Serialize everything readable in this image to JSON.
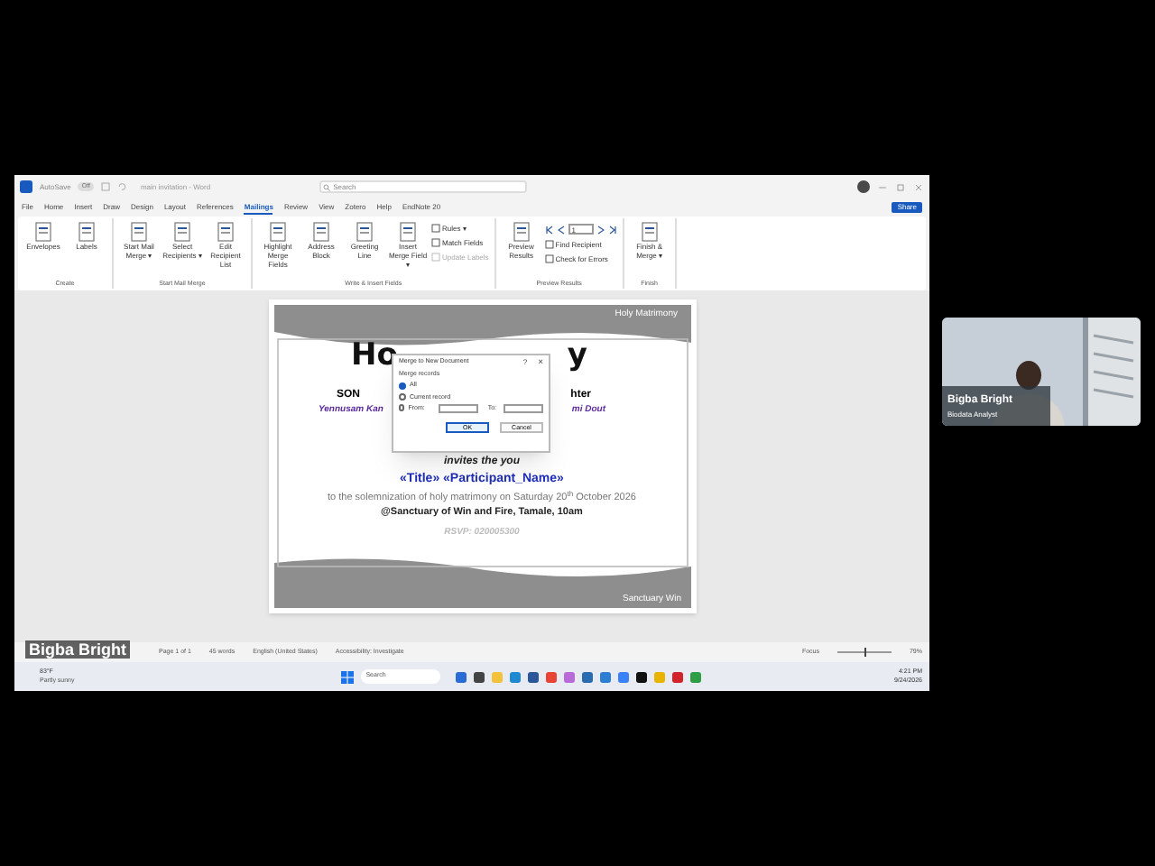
{
  "window": {
    "autosave": "AutoSave",
    "autosave_state": "Off",
    "title": "main invitation - Word",
    "search": {
      "placeholder": "Search"
    },
    "share": "Share"
  },
  "menu_tabs": [
    {
      "label": "File",
      "selected": false
    },
    {
      "label": "Home",
      "selected": false
    },
    {
      "label": "Insert",
      "selected": false
    },
    {
      "label": "Draw",
      "selected": false
    },
    {
      "label": "Design",
      "selected": false
    },
    {
      "label": "Layout",
      "selected": false
    },
    {
      "label": "References",
      "selected": false
    },
    {
      "label": "Mailings",
      "selected": true
    },
    {
      "label": "Review",
      "selected": false
    },
    {
      "label": "View",
      "selected": false
    },
    {
      "label": "Zotero",
      "selected": false
    },
    {
      "label": "Help",
      "selected": false
    },
    {
      "label": "EndNote 20",
      "selected": false
    }
  ],
  "ribbon": [
    {
      "label": "Create",
      "items": [
        {
          "kind": "large",
          "label": "Envelopes",
          "disabled": false
        },
        {
          "kind": "large",
          "label": "Labels",
          "disabled": false
        }
      ]
    },
    {
      "label": "Start Mail Merge",
      "items": [
        {
          "kind": "large",
          "label": "Start Mail Merge ▾",
          "disabled": false
        },
        {
          "kind": "large",
          "label": "Select Recipients ▾",
          "disabled": false
        },
        {
          "kind": "large",
          "label": "Edit Recipient List",
          "disabled": false
        }
      ]
    },
    {
      "label": "Write & Insert Fields",
      "items": [
        {
          "kind": "large",
          "label": "Highlight Merge Fields",
          "disabled": false
        },
        {
          "kind": "large",
          "label": "Address Block",
          "disabled": false
        },
        {
          "kind": "large",
          "label": "Greeting Line",
          "disabled": false
        },
        {
          "kind": "large",
          "label": "Insert Merge Field ▾",
          "disabled": false
        },
        {
          "kind": "small",
          "label": "Rules ▾",
          "disabled": false
        },
        {
          "kind": "small",
          "label": "Match Fields",
          "disabled": false
        },
        {
          "kind": "small",
          "label": "Update Labels",
          "disabled": true
        }
      ]
    },
    {
      "label": "Preview Results",
      "items": [
        {
          "kind": "large",
          "label": "Preview Results",
          "disabled": false
        },
        {
          "kind": "nav",
          "label": "1",
          "disabled": false
        },
        {
          "kind": "small",
          "label": "Find Recipient",
          "disabled": false
        },
        {
          "kind": "small",
          "label": "Check for Errors",
          "disabled": false
        }
      ]
    },
    {
      "label": "Finish",
      "items": [
        {
          "kind": "large",
          "label": "Finish & Merge ▾",
          "disabled": false
        }
      ]
    }
  ],
  "document": {
    "header_tag": "Holy Matrimony",
    "title_left": "Ho",
    "title_right": "y",
    "left_role": "SON",
    "right_role": "hter",
    "left_name": "Yennusam Kan",
    "right_name": "mi Dout",
    "invites": "invites the you",
    "merge_fields": "«Title» «Participant_Name»",
    "line_1": "to the solemnization of holy matrimony on Saturday 20$^{th}$ October 2026",
    "line_2": "@Sanctuary of Win and Fire, Tamale, 10am",
    "rsvp": "RSVP: 020005300",
    "footer_tag": "Sanctuary Win"
  },
  "dialog": {
    "title": "Merge to New Document",
    "help": "?",
    "close": "×",
    "group": "Merge records",
    "options": [
      {
        "label": "All",
        "selected": true
      },
      {
        "label": "Current record",
        "selected": false
      },
      {
        "label": "From:",
        "selected": false
      }
    ],
    "to_label": "To:",
    "buttons": [
      "OK",
      "Cancel"
    ]
  },
  "status_bar": {
    "left": [
      "Page 1 of 1",
      "45 words",
      "English (United States)",
      "Accessibility: Investigate"
    ],
    "focus": "Focus",
    "zoom": {
      "level": 0.5
    },
    "zoom_reading": "79%"
  },
  "taskbar": {
    "weather_temp": "83°F",
    "weather_text": "Partly sunny",
    "search": "Search",
    "time": "4:21 PM",
    "date": "9/24/2026"
  },
  "video": {
    "name": "Bigba Bright",
    "role": "Biodata Analyst",
    "overlay_name": "Bigba Bright"
  }
}
